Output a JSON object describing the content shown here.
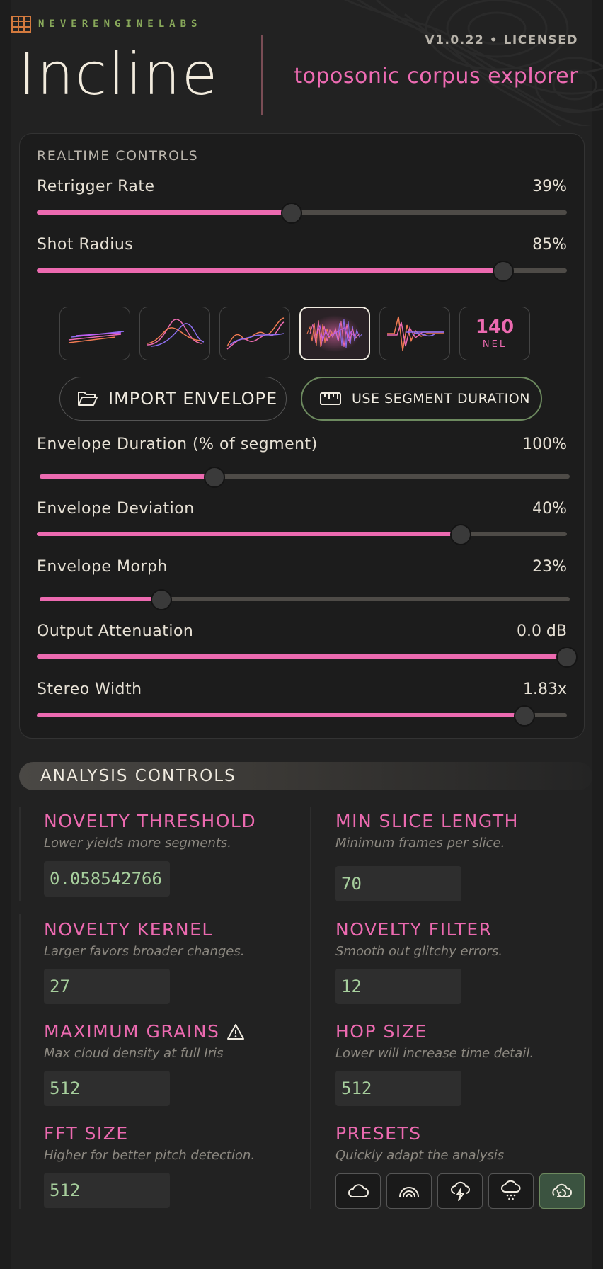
{
  "header": {
    "brand": "NEVERENGINELABS",
    "title": "Incline",
    "version": "V1.0.22 • LICENSED",
    "subtitle": "toposonic corpus explorer"
  },
  "realtime": {
    "section_label": "REALTIME CONTROLS",
    "sliders": [
      {
        "label": "Retrigger Rate",
        "value": "39%",
        "level": 0.48
      },
      {
        "label": "Shot Radius",
        "value": "85%",
        "level": 0.88
      },
      {
        "label": "Envelope Duration (% of segment)",
        "value": "100%",
        "level": 0.33
      },
      {
        "label": "Envelope Deviation",
        "value": "40%",
        "level": 0.8
      },
      {
        "label": "Envelope Morph",
        "value": "23%",
        "level": 0.23
      },
      {
        "label": "Output Attenuation",
        "value": "0.0 dB",
        "level": 1.0
      },
      {
        "label": "Stereo Width",
        "value": "1.83x",
        "level": 0.92
      }
    ],
    "envelopes": [
      {
        "name": "envelope-flat-lines"
      },
      {
        "name": "envelope-bell-curves"
      },
      {
        "name": "envelope-rising-wave"
      },
      {
        "name": "envelope-dense-burst",
        "selected": true
      },
      {
        "name": "envelope-oscillation"
      }
    ],
    "nel_number": "140",
    "nel_label": "NEL",
    "import_label": "IMPORT ENVELOPE",
    "segment_label": "USE SEGMENT DURATION"
  },
  "analysis": {
    "section_label": "ANALYSIS CONTROLS",
    "fields": [
      {
        "title": "NOVELTY THRESHOLD",
        "desc": "Lower yields more segments.",
        "value": "0.058542766"
      },
      {
        "title": "MIN SLICE LENGTH",
        "desc": "Minimum frames per slice.",
        "value": "70"
      },
      {
        "title": "NOVELTY KERNEL",
        "desc": "Larger favors broader changes.",
        "value": "27"
      },
      {
        "title": "NOVELTY FILTER",
        "desc": "Smooth out glitchy errors.",
        "value": "12"
      },
      {
        "title": "MAXIMUM GRAINS",
        "desc": "Max cloud density at full Iris",
        "value": "512",
        "warning": true
      },
      {
        "title": "HOP SIZE",
        "desc": "Lower will increase time detail.",
        "value": "512"
      },
      {
        "title": "FFT SIZE",
        "desc": "Higher for better pitch detection.",
        "value": "512"
      }
    ],
    "presets": {
      "title": "PRESETS",
      "desc": "Quickly adapt the analysis",
      "buttons": [
        {
          "icon": "cloud-icon"
        },
        {
          "icon": "rainbow-icon"
        },
        {
          "icon": "lightning-cloud-icon"
        },
        {
          "icon": "rain-cloud-icon"
        },
        {
          "icon": "cloud-reset-icon",
          "selected": true
        }
      ]
    }
  },
  "colors": {
    "accent": "#ec6ab0",
    "value_green": "#a7cf9d",
    "brand_green": "#88a85a",
    "panel": "#1c1c1c"
  }
}
